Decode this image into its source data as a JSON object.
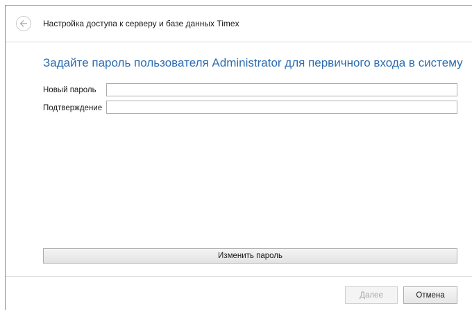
{
  "header": {
    "title": "Настройка доступа к серверу и базе данных Timex",
    "back_icon": "back-arrow-icon"
  },
  "form": {
    "heading": "Задайте пароль пользователя Administrator для первичного входа в систему",
    "new_password_label": "Новый пароль",
    "new_password_value": "",
    "confirm_label": "Подтверждение",
    "confirm_value": "",
    "change_password_label": "Изменить пароль"
  },
  "footer": {
    "next_label": "Далее",
    "next_enabled": false,
    "cancel_label": "Отмена"
  },
  "colors": {
    "heading": "#2b6cb0",
    "border": "#8a8a8a"
  }
}
